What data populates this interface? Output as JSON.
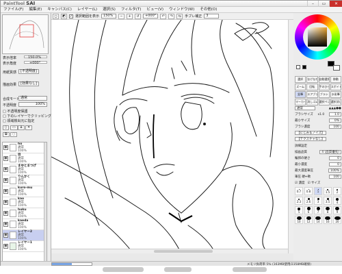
{
  "app": {
    "logo_small": "PaintTool",
    "logo_big": "SAI"
  },
  "menu": [
    "ファイル(F)",
    "編集(E)",
    "キャンバス(C)",
    "レイヤー(L)",
    "選択(S)",
    "フィルタ(T)",
    "ビュー(V)",
    "ウィンドウ(W)",
    "その他(O)"
  ],
  "toolbar": {
    "selection_label": "選択範囲を表示",
    "zoom": "150%",
    "angle": "+000°",
    "stabilizer_label": "手ブレ補正",
    "stabilizer_value": "3"
  },
  "navigator": {
    "zoom_label": "表示倍率",
    "zoom_value": "150.0%",
    "angle_label": "表示角度",
    "angle_value": "+000°"
  },
  "side": {
    "btn1": "[不透明度]",
    "btn2": "[効果なし]",
    "mode_label": "合成モード",
    "mode_value": "通常",
    "opacity_label": "不透明度",
    "opacity_value": "100%",
    "check1": "不透明度保護",
    "check2": "下のレイヤーでクリッピング",
    "check3": "領域検出元に指定"
  },
  "layers": [
    {
      "name": "ho",
      "mode": "通常",
      "opacity": "100%"
    },
    {
      "name": "目",
      "mode": "通常",
      "opacity": "100%"
    },
    {
      "name": "まゆとまつげ",
      "mode": "通常",
      "opacity": "100%"
    },
    {
      "name": "りんかく",
      "mode": "通常",
      "opacity": "100%"
    },
    {
      "name": "kuro-mu",
      "mode": "通常",
      "opacity": "100%"
    },
    {
      "name": "kao",
      "mode": "通常",
      "opacity": "100%"
    },
    {
      "name": "huku",
      "mode": "通常",
      "opacity": "100%"
    },
    {
      "name": "kaeda",
      "mode": "通常",
      "opacity": "100%"
    },
    {
      "name": "レイヤー2",
      "mode": "通常",
      "opacity": "100%",
      "selected": true
    },
    {
      "name": "レイヤー1",
      "mode": "通常",
      "opacity": "100%"
    }
  ],
  "tools": [
    "選択",
    "なげなわ",
    "自動選択",
    "移動",
    "ズーム",
    "回転",
    "手のひら",
    "スポイト",
    "鉛筆",
    "エアブラシ",
    "ブラシ",
    "水彩筆",
    "マーカー",
    "消しゴム",
    "選択ペン",
    "選択消し"
  ],
  "brush": {
    "mode": "通常",
    "size_label": "ブラシサイズ",
    "size_mult": "x1.0",
    "size_value": "1.0",
    "min_label": "最小サイズ",
    "min_value": "0%",
    "density_label": "ブラシ濃度",
    "density_value": "100",
    "shape": "【にじみ＆ノイズ】",
    "texture": "【テクスチャなし】",
    "detail_label": "詳細設定",
    "quality_label": "描画品質",
    "quality_value": "4 (品質優先)",
    "edge_label": "輪郭の硬さ",
    "edge_value": "0",
    "min_density_label": "最小濃度",
    "min_density_value": "0",
    "max_density_label": "最大濃度筆圧",
    "max_density_value": "100%",
    "pressure_label": "筆圧 硬⇔軟",
    "pressure_value": "100",
    "press_density": "濃度",
    "press_size": "サイズ"
  },
  "sizes": [
    "0.7",
    "0.8",
    "1",
    "1.5",
    "2",
    "2.3",
    "2.6",
    "3",
    "3.5",
    "4",
    "5",
    "6",
    "7",
    "8",
    "9",
    "10",
    "12",
    "14",
    "16",
    "20"
  ],
  "status": {
    "text": "メモリ負荷率 5% (163MB使用/2358MB確保)",
    "progress": 0.5
  },
  "colors": {
    "primary": "#000000",
    "secondary": "#ffffff",
    "selected_layer": "#c8cff0",
    "accent": "#e8a028"
  }
}
